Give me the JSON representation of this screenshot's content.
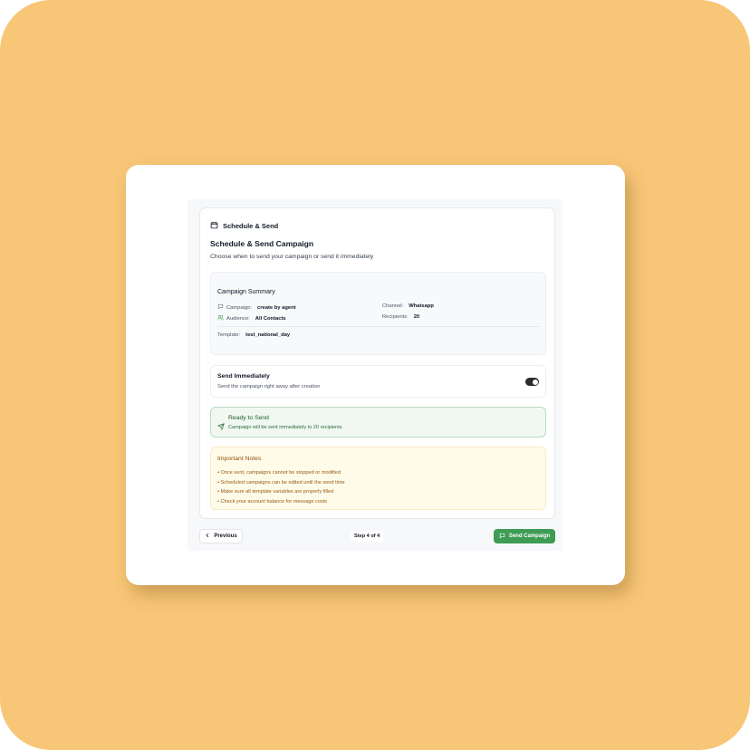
{
  "colors": {
    "background": "#f8c677",
    "accent_green": "#3f9c55",
    "ready_bg": "#f0f8f1",
    "notes_bg": "#fefbe9",
    "notes_text": "#92500e"
  },
  "card": {
    "header_title": "Schedule & Send",
    "header_icon": "calendar-icon",
    "title": "Schedule & Send Campaign",
    "subtitle": "Choose when to send your campaign or send it immediately"
  },
  "summary": {
    "title": "Campaign Summary",
    "campaign_label": "Campaign:",
    "campaign_value": "create by agent",
    "campaign_icon": "message-icon",
    "channel_label": "Channel:",
    "channel_value": "Whatsapp",
    "audience_label": "Audience:",
    "audience_value": "All Contacts",
    "audience_icon": "users-icon",
    "recipients_label": "Recipients:",
    "recipients_value": "20",
    "template_label": "Template:",
    "template_value": "test_national_day"
  },
  "send_immediately": {
    "title": "Send Immediately",
    "description": "Send the campaign right away after creation",
    "enabled": true
  },
  "ready": {
    "icon": "send-icon",
    "title": "Ready to Send",
    "description": "Campaign will be sent immediately to 20 recipients"
  },
  "notes": {
    "title": "Important Notes",
    "items": [
      "• Once sent, campaigns cannot be stopped or modified",
      "• Scheduled campaigns can be edited until the send time",
      "• Make sure all template variables are properly filled",
      "• Check your account balance for message costs"
    ]
  },
  "footer": {
    "previous_label": "Previous",
    "step_text": "Step 4 of 4",
    "send_label": "Send Campaign"
  }
}
